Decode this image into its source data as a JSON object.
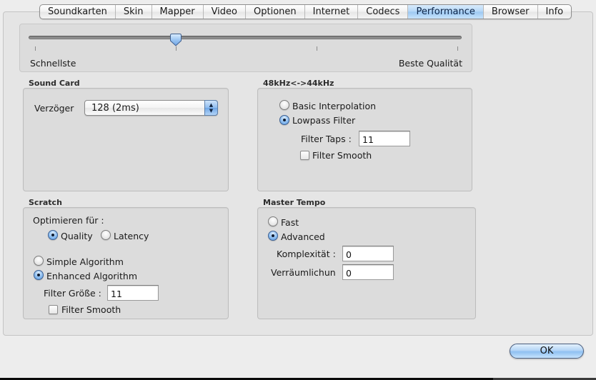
{
  "tabs": [
    {
      "label": "Soundkarten",
      "active": false
    },
    {
      "label": "Skin",
      "active": false
    },
    {
      "label": "Mapper",
      "active": false
    },
    {
      "label": "Video",
      "active": false
    },
    {
      "label": "Optionen",
      "active": false
    },
    {
      "label": "Internet",
      "active": false
    },
    {
      "label": "Codecs",
      "active": false
    },
    {
      "label": "Performance",
      "active": true
    },
    {
      "label": "Browser",
      "active": false
    },
    {
      "label": "Info",
      "active": false
    }
  ],
  "quality_slider": {
    "min_label": "Schnellste",
    "max_label": "Beste Qualität",
    "tick_count": 4,
    "value_index": 1
  },
  "sound_card": {
    "title": "Sound Card",
    "delay_label": "Verzöger",
    "delay_value": "128 (2ms)",
    "popup_arrows": "▲▼"
  },
  "resample": {
    "title": "48kHz<->44kHz",
    "options": [
      {
        "label": "Basic Interpolation",
        "selected": false
      },
      {
        "label": "Lowpass Filter",
        "selected": true
      }
    ],
    "filter_taps_label": "Filter Taps :",
    "filter_taps_value": "11",
    "filter_smooth_label": "Filter Smooth",
    "filter_smooth_checked": false
  },
  "scratch": {
    "title": "Scratch",
    "optimize_label": "Optimieren für :",
    "optimize_options": [
      {
        "label": "Quality",
        "selected": true
      },
      {
        "label": "Latency",
        "selected": false
      }
    ],
    "algorithm_options": [
      {
        "label": "Simple Algorithm",
        "selected": false
      },
      {
        "label": "Enhanced Algorithm",
        "selected": true
      }
    ],
    "filter_size_label": "Filter Größe :",
    "filter_size_value": "11",
    "filter_smooth_label": "Filter Smooth",
    "filter_smooth_checked": false
  },
  "master_tempo": {
    "title": "Master Tempo",
    "options": [
      {
        "label": "Fast",
        "selected": false
      },
      {
        "label": "Advanced",
        "selected": true
      }
    ],
    "complexity_label": "Komplexität :",
    "complexity_value": "0",
    "spatial_label": "Verräumlichun",
    "spatial_value": "0"
  },
  "ok_label": "OK"
}
